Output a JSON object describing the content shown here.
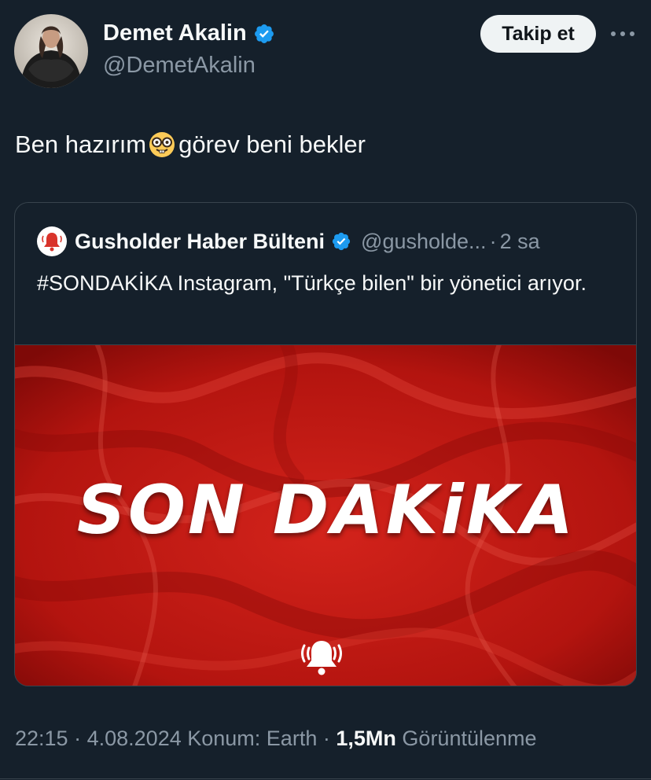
{
  "author": {
    "display_name": "Demet Akalin",
    "handle": "@DemetAkalin",
    "verified": true
  },
  "follow_button_label": "Takip et",
  "more_icon": "more-horizontal-icon",
  "tweet": {
    "text_before_emoji": "Ben hazırım",
    "emoji": "nerd-face-emoji",
    "text_after_emoji": "görev beni bekler"
  },
  "quoted_tweet": {
    "display_name": "Gusholder Haber Bülteni",
    "handle": "@gusholde...",
    "separator": "·",
    "time": "2 sa",
    "verified": true,
    "text": "#SONDAKİKA Instagram, \"Türkçe bilen\" bir yönetici arıyor.",
    "media": {
      "title": "SON DAKiKA",
      "icon": "bell-ringing-icon"
    }
  },
  "meta": {
    "time": "22:15",
    "separator1": "·",
    "date": "4.08.2024",
    "location": "Konum: Earth",
    "separator2": "·",
    "views_count": "1,5Mn",
    "views_label": "Görüntülenme"
  },
  "colors": {
    "background": "#15202b",
    "primary_text": "#f7f9f9",
    "secondary_text": "#8b98a5",
    "verified_blue": "#1d9bf0",
    "border": "#38444d",
    "media_red": "#b3120f"
  }
}
